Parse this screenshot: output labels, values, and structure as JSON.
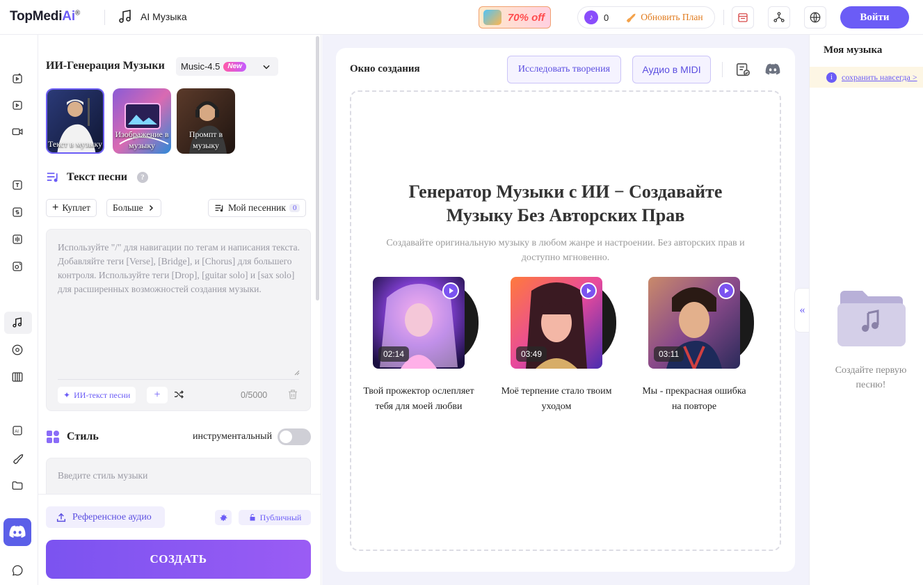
{
  "header": {
    "logo_main": "TopMedi",
    "logo_ai": "Ai",
    "logo_reg": "®",
    "app_title": "AI Музыка",
    "promo": "70% off",
    "credits": "0",
    "upgrade": "Обновить План",
    "login": "Войти"
  },
  "panel": {
    "title": "ИИ-Генерация Музыки",
    "model": "Music-4.5",
    "model_badge": "New",
    "modes": [
      {
        "label": "Текст в музыку",
        "active": true
      },
      {
        "label": "Изображение в музыку",
        "active": false
      },
      {
        "label": "Промпт в музыку",
        "active": false
      }
    ],
    "lyrics_heading": "Текст песни",
    "verse_btn": "Куплет",
    "more_btn": "Больше",
    "songbook_btn": "Мой песенник",
    "songbook_count": "0",
    "lyrics_placeholder": "Используйте \"/\" для навигации по тегам и написания текста. Добавляйте теги [Verse], [Bridge], и [Chorus] для большего контроля. Используйте теги [Drop], [guitar solo] и [sax solo] для расширенных возможностей создания музыки.",
    "ai_lyrics_btn": "ИИ-текст песни",
    "char_count": "0/5000",
    "style_heading": "Стиль",
    "instrumental_label": "инструментальный",
    "instrumental_on": false,
    "style_placeholder": "Введите стиль музыки",
    "ref_audio": "Референсное аудио",
    "public_btn": "Публичный",
    "create_btn": "СОЗДАТЬ"
  },
  "main": {
    "title": "Окно создания",
    "explore_btn": "Исследовать творения",
    "midi_btn": "Аудио в MIDI",
    "hero_title": "Генератор Музыки с ИИ − Создавайте Музыку Без Авторских Прав",
    "hero_sub": "Создавайте оригинальную музыку в любом жанре и настроении. Без авторских прав и доступно мгновенно.",
    "songs": [
      {
        "duration": "02:14",
        "title": "Твой прожектор ослепляет тебя для моей любви"
      },
      {
        "duration": "03:49",
        "title": "Моё терпение стало твоим уходом"
      },
      {
        "duration": "03:11",
        "title": "Мы - прекрасная ошибка на повторе"
      }
    ]
  },
  "right": {
    "title": "Моя музыка",
    "save_link": "сохранить навсегда >",
    "empty_text": "Создайте первую песню!"
  },
  "colors": {
    "accent": "#6b5cf6",
    "create_gradient_start": "#7b53f0",
    "create_gradient_end": "#9a5cf4",
    "promo_red": "#ff4d4f",
    "upgrade_orange": "#e07a1c"
  },
  "icons": {
    "rail": [
      "image-to-video-icon",
      "photo-video-icon",
      "video-camera-icon",
      "text-to-speech-icon",
      "speech-to-text-icon",
      "voice-changer-icon",
      "voice-clone-icon",
      "music-note-icon",
      "vinyl-icon",
      "piano-icon",
      "ai-chip-icon",
      "rocket-icon",
      "folder-icon",
      "discord-icon",
      "chat-icon"
    ]
  }
}
